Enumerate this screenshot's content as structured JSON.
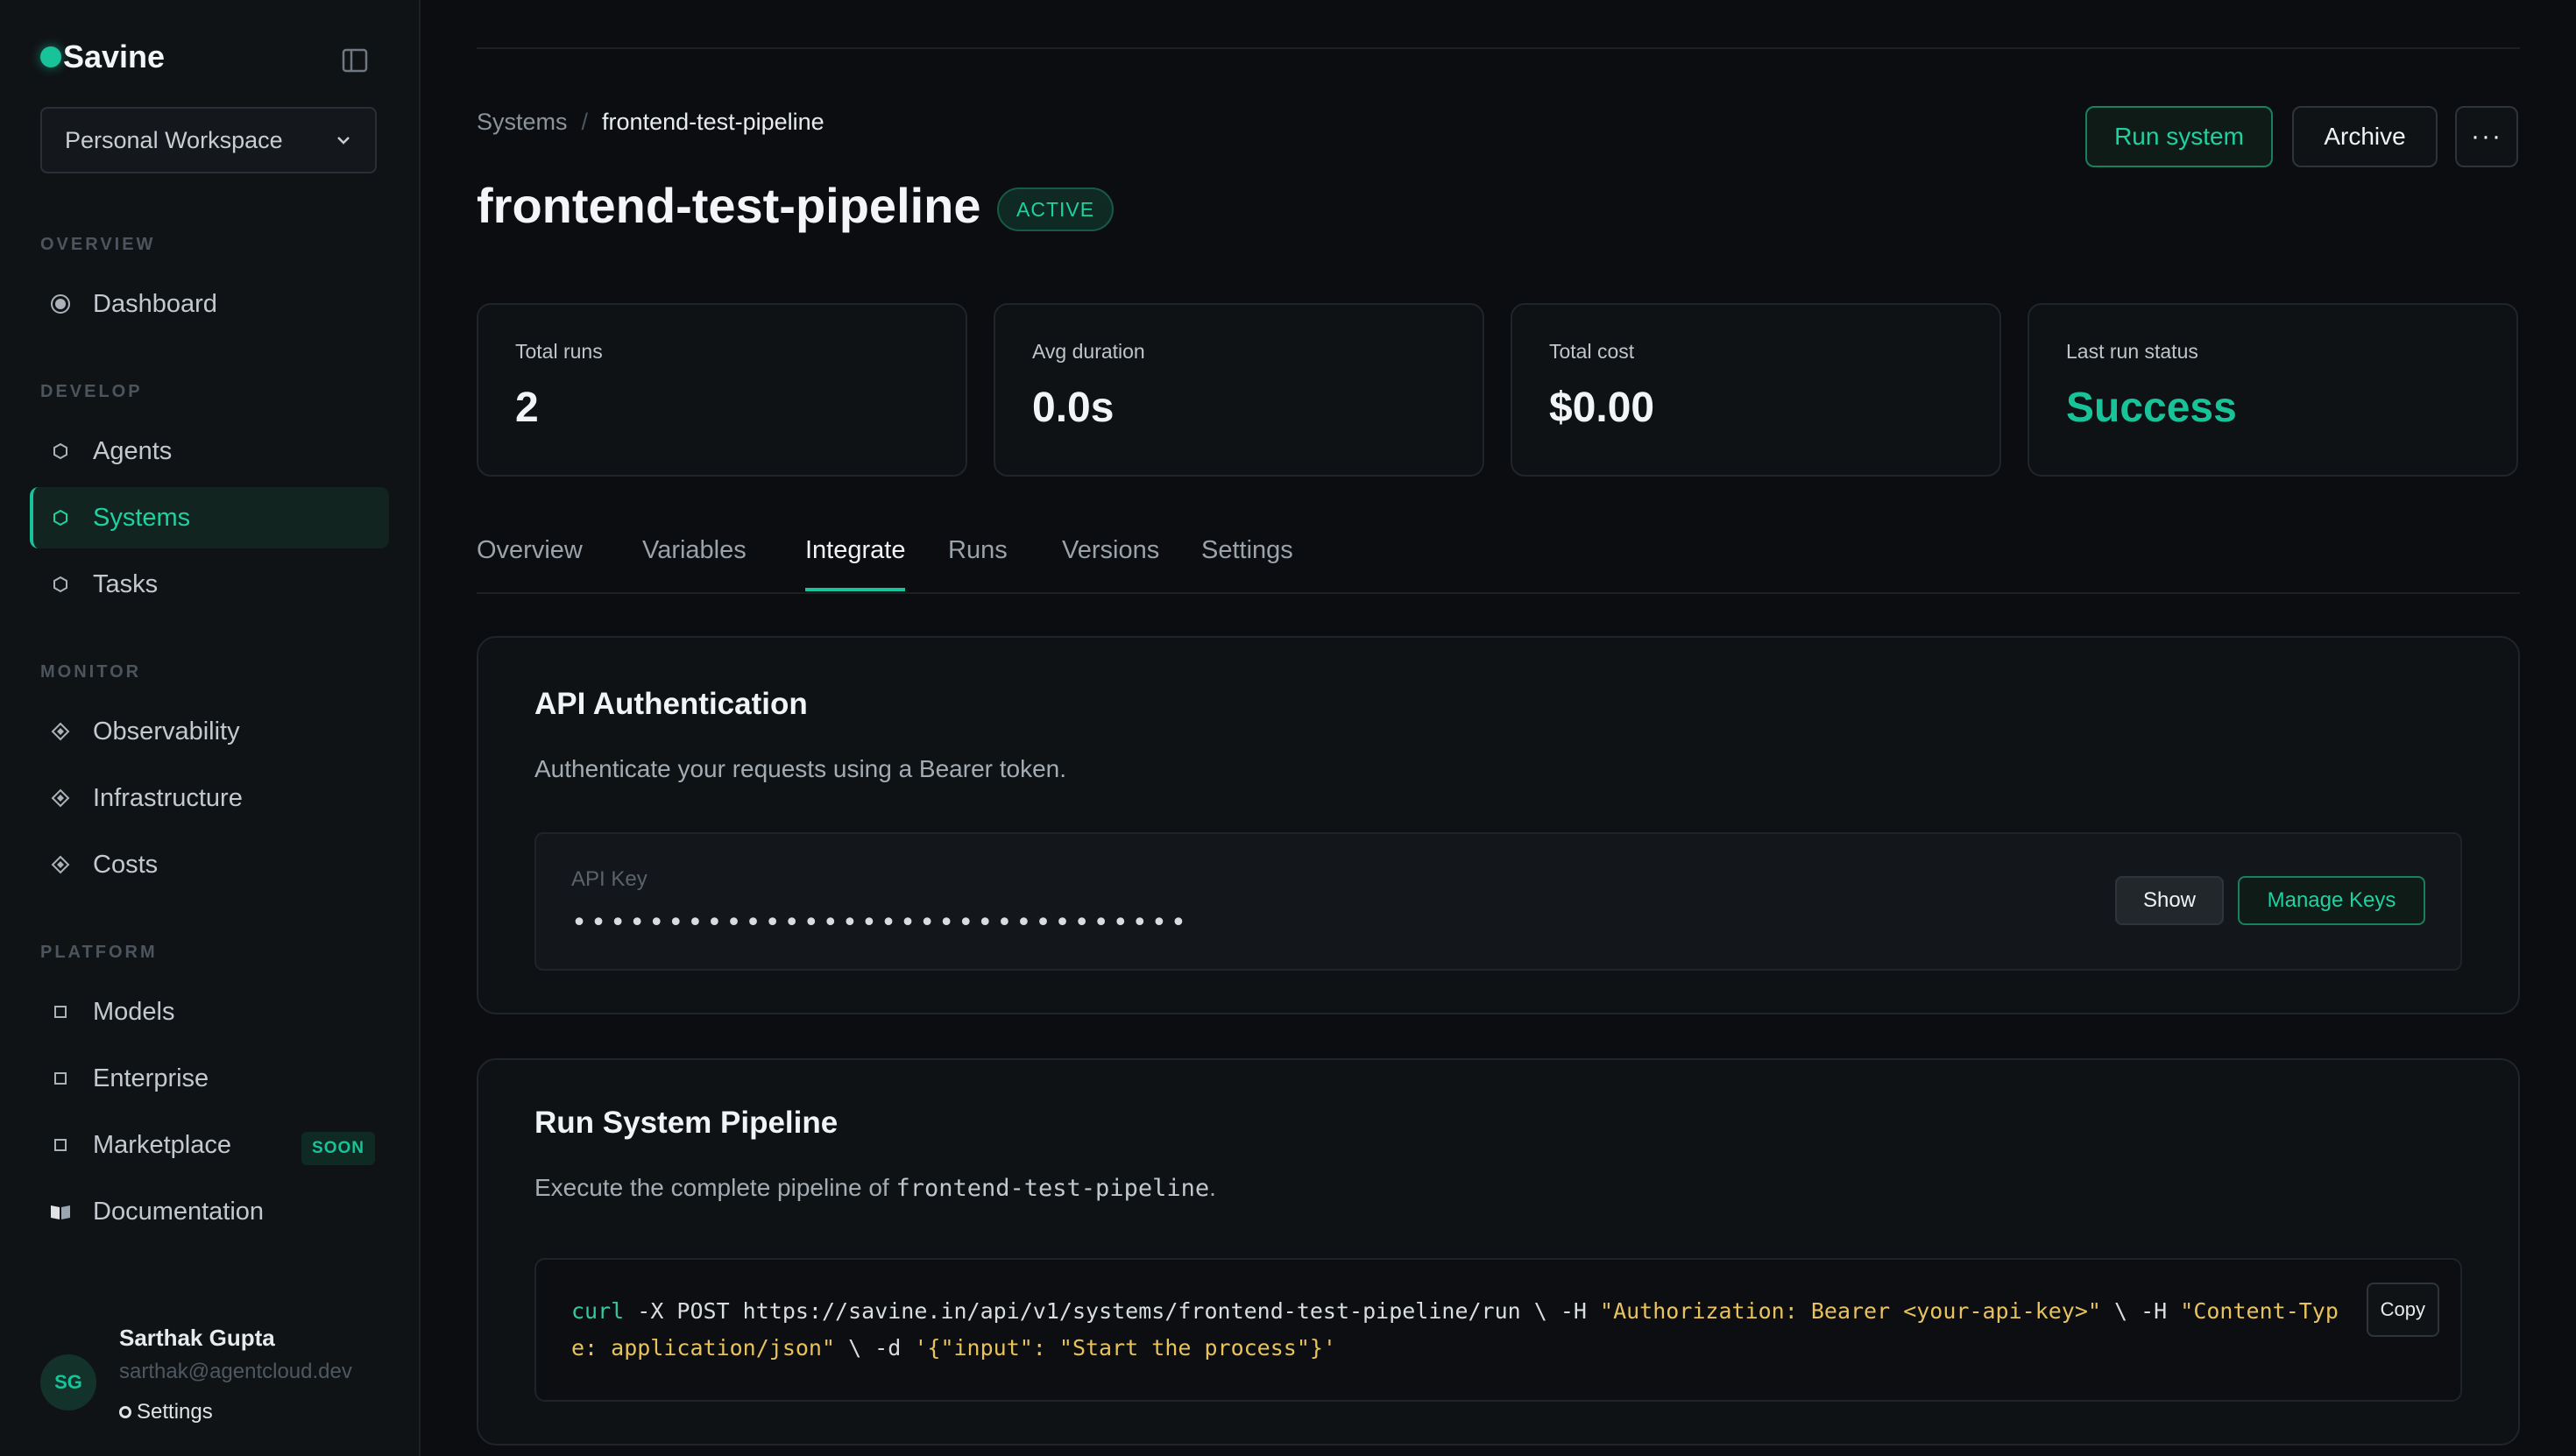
{
  "sidebar": {
    "brand": "Savine",
    "workspace": "Personal Workspace",
    "sections": {
      "overview": "OVERVIEW",
      "develop": "DEVELOP",
      "monitor": "MONITOR",
      "platform": "PLATFORM"
    },
    "items": {
      "dashboard": "Dashboard",
      "agents": "Agents",
      "systems": "Systems",
      "tasks": "Tasks",
      "observability": "Observability",
      "infrastructure": "Infrastructure",
      "costs": "Costs",
      "models": "Models",
      "enterprise": "Enterprise",
      "marketplace": "Marketplace",
      "documentation": "Documentation"
    },
    "soon_badge": "SOON",
    "user": {
      "initials": "SG",
      "name": "Sarthak Gupta",
      "email": "sarthak@agentcloud.dev",
      "settings": "Settings"
    }
  },
  "header": {
    "breadcrumb": [
      "Systems",
      "/",
      "frontend-test-pipeline"
    ],
    "title": "frontend-test-pipeline",
    "status": "ACTIVE",
    "run_label": "Run system",
    "archive_label": "Archive",
    "more_label": "···"
  },
  "stats": [
    {
      "label": "Total runs",
      "value": "2"
    },
    {
      "label": "Avg duration",
      "value": "0.0s"
    },
    {
      "label": "Total cost",
      "value": "$0.00"
    },
    {
      "label": "Last run status",
      "value": "Success"
    }
  ],
  "tabs": [
    "Overview",
    "Variables",
    "Integrate",
    "Runs",
    "Versions",
    "Settings"
  ],
  "active_tab": "Integrate",
  "auth": {
    "title": "API Authentication",
    "description": "Authenticate your requests using a Bearer token.",
    "key_label": "API Key",
    "key_mask": "••••••••••••••••••••••••••••••••",
    "show_label": "Show",
    "manage_label": "Manage Keys"
  },
  "pipeline": {
    "title": "Run System Pipeline",
    "description_prefix": "Execute the complete pipeline of ",
    "description_code": "frontend-test-pipeline",
    "description_suffix": ".",
    "code": {
      "cmd": "curl",
      "part1": " -X POST https://savine.in/api/v1/systems/frontend-test-pipeline/run \\ -H ",
      "auth_header": "\"Authorization: Bearer <your-api-key>\"",
      "part2": " \\ -H ",
      "content_header": "\"Content-Type: application/json\"",
      "part3": " \\ -d ",
      "body": "'{\"input\": \"Start the process\"}'"
    },
    "copy_label": "Copy"
  },
  "colors": {
    "accent": "#19c39a",
    "background": "#0b0d10",
    "sidebar": "#101316",
    "string": "#e8c25c"
  }
}
